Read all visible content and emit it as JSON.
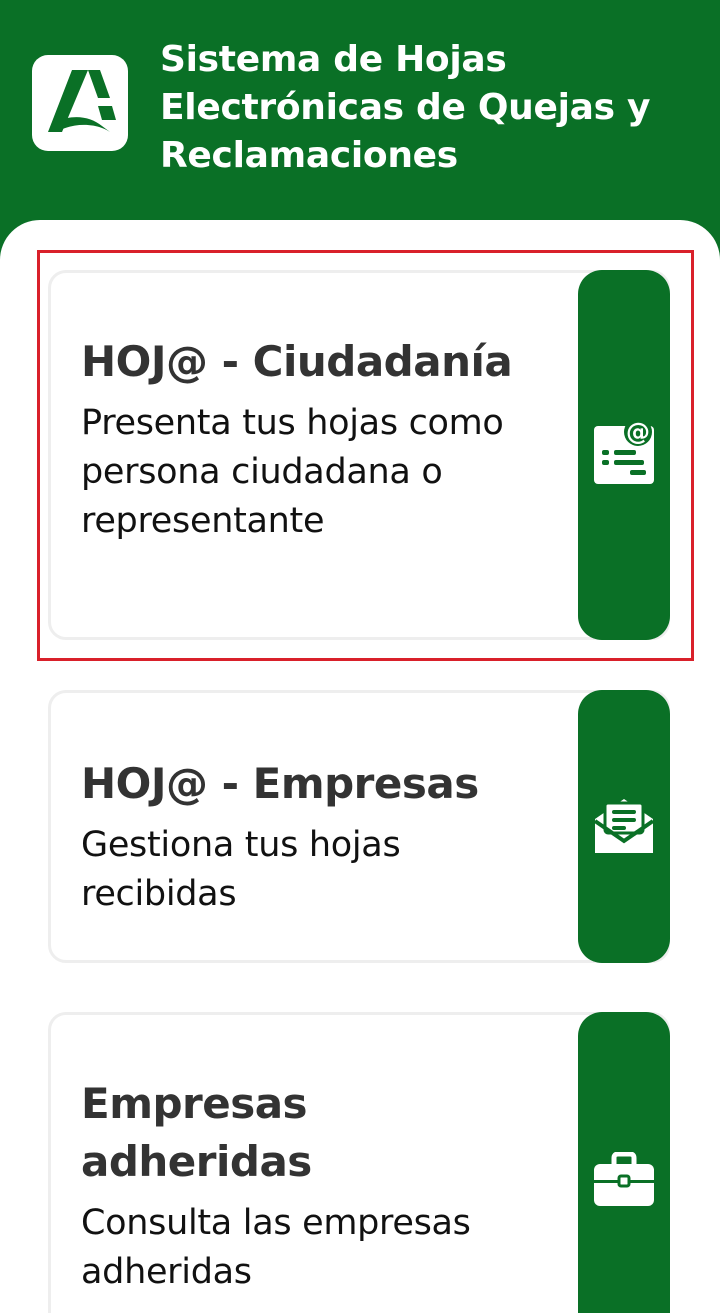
{
  "header": {
    "title": "Sistema de Hojas Electrónicas de Quejas y Reclamaciones",
    "logo_icon": "junta-andalucia-logo-icon",
    "background_color": "#0a7026"
  },
  "cards": [
    {
      "title": "HOJ@ - Ciudadanía",
      "description": "Presenta tus hojas como persona ciudadana o representante",
      "icon": "document-at-icon",
      "highlighted": true
    },
    {
      "title": "HOJ@ - Empresas",
      "description": "Gestiona tus hojas recibidas",
      "icon": "open-envelope-icon"
    },
    {
      "title": "Empresas adheridas",
      "description": "Consulta las empresas adheridas",
      "icon": "briefcase-icon"
    }
  ],
  "colors": {
    "accent": "#0a7026",
    "highlight": "#d9202a",
    "title_text": "#333333"
  }
}
